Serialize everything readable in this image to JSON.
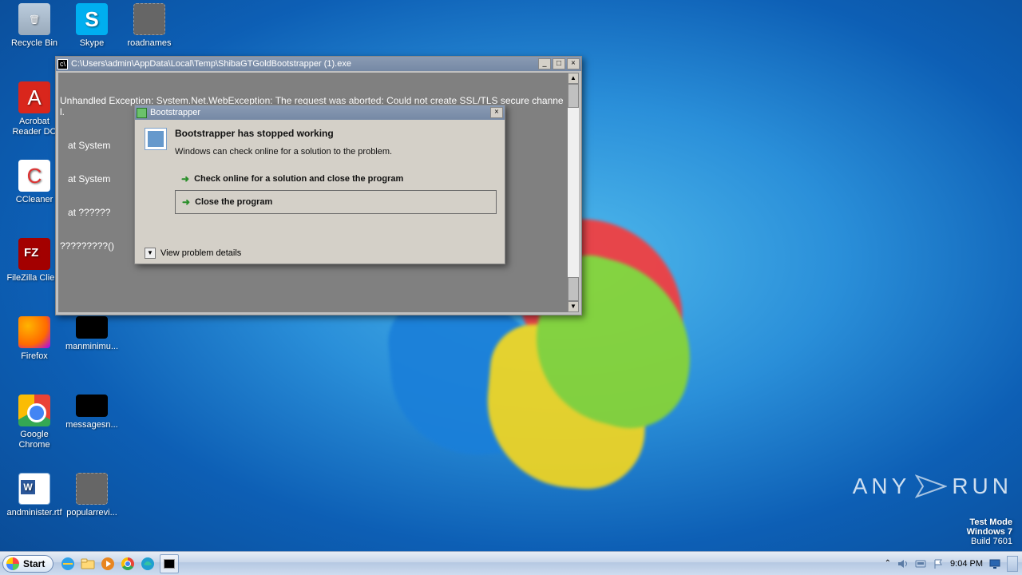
{
  "watermarks": {
    "brand": "ANY",
    "brand2": "RUN",
    "test_mode": "Test Mode",
    "os": "Windows 7",
    "build": "Build 7601"
  },
  "desktop": {
    "icons": [
      {
        "name": "Recycle Bin"
      },
      {
        "name": "Skype"
      },
      {
        "name": "roadnames"
      },
      {
        "name": "Acrobat Reader DC"
      },
      {
        "name": "CCleaner"
      },
      {
        "name": "FileZilla Client"
      },
      {
        "name": "Firefox"
      },
      {
        "name": "manminimu..."
      },
      {
        "name": "Google Chrome"
      },
      {
        "name": "messagesn..."
      },
      {
        "name": "andminister.rtf"
      },
      {
        "name": "popularrevi..."
      }
    ]
  },
  "console": {
    "title": "C:\\Users\\admin\\AppData\\Local\\Temp\\ShibaGTGoldBootstrapper (1).exe",
    "lines": [
      "Unhandled Exception: System.Net.WebException: The request was aborted: Could not create SSL/TLS secure channel.",
      "   at System",
      "   at System                                                     e)",
      "   at ??????                                                     ??????????",
      "?????????()"
    ]
  },
  "dialog": {
    "title": "Bootstrapper",
    "heading": "Bootstrapper has stopped working",
    "body": "Windows can check online for a solution to the problem.",
    "option1": "Check online for a solution and close the program",
    "option2": "Close the program",
    "details": "View problem details"
  },
  "taskbar": {
    "start": "Start",
    "clock": "9:04 PM"
  }
}
